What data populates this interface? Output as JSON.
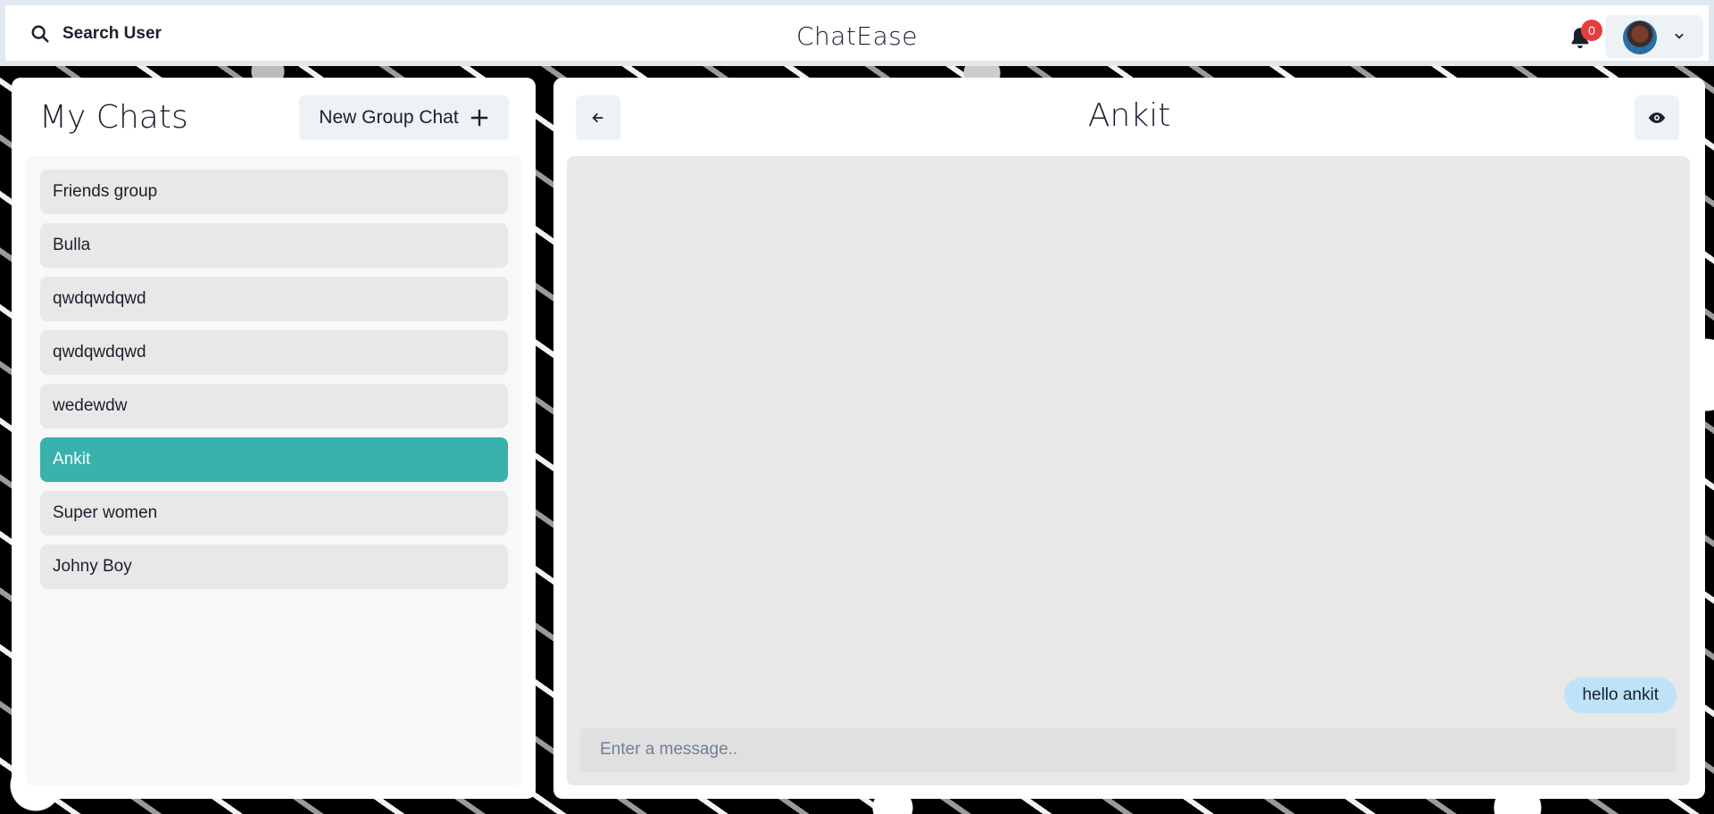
{
  "header": {
    "search_label": "Search User",
    "app_title": "ChatEase",
    "notification_count": "0"
  },
  "sidebar": {
    "title": "My Chats",
    "new_group_label": "New Group Chat",
    "chats": [
      {
        "name": "Friends group",
        "active": false
      },
      {
        "name": "Bulla",
        "active": false
      },
      {
        "name": "qwdqwdqwd",
        "active": false
      },
      {
        "name": "qwdqwdqwd",
        "active": false
      },
      {
        "name": "wedewdw",
        "active": false
      },
      {
        "name": "Ankit",
        "active": true
      },
      {
        "name": "Super women",
        "active": false
      },
      {
        "name": "Johny Boy",
        "active": false
      }
    ]
  },
  "chat": {
    "title": "Ankit",
    "messages": [
      {
        "text": "hello ankit",
        "own": true
      }
    ],
    "input_placeholder": "Enter a message.."
  },
  "colors": {
    "accent": "#38b2ac",
    "own_bubble": "#bee3f8",
    "badge": "#e53e3e"
  }
}
